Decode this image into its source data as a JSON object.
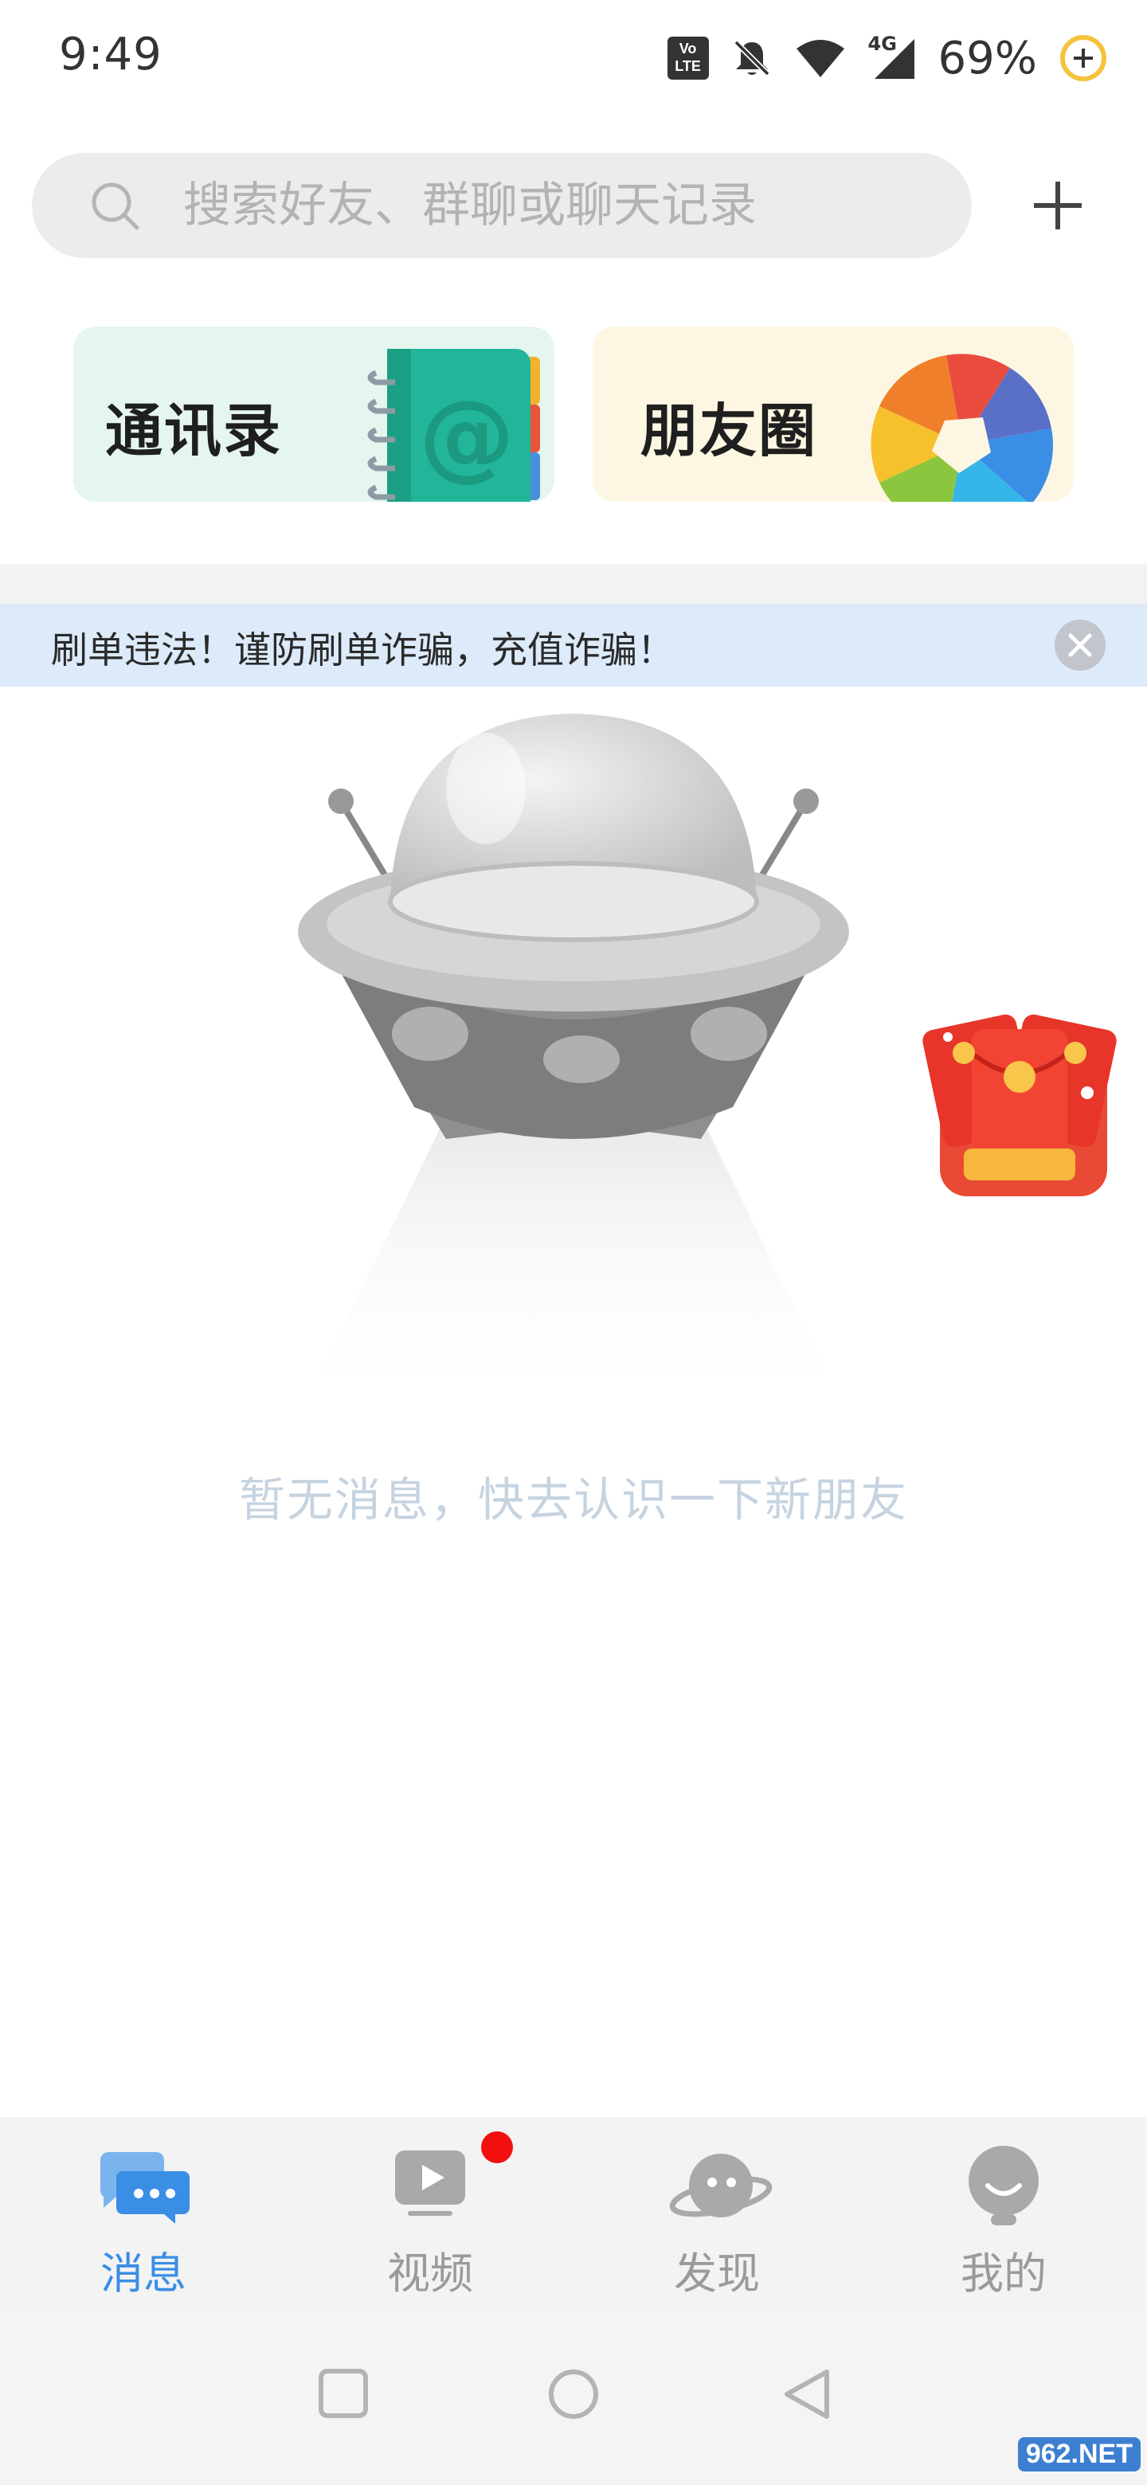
{
  "status_bar": {
    "time": "9:49",
    "network": "4G",
    "battery_percent": "69%",
    "icons": [
      "volte-icon",
      "mute-bell-icon",
      "wifi-icon",
      "signal-icon",
      "battery-saver-icon"
    ]
  },
  "search": {
    "placeholder": "搜索好友、群聊或聊天记录",
    "value": ""
  },
  "shortcuts": {
    "contacts_label": "通讯录",
    "moments_label": "朋友圈"
  },
  "notice": {
    "text": "刷单违法！谨防刷单诈骗，充值诈骗！"
  },
  "empty_state": {
    "text": "暂无消息，快去认识一下新朋友"
  },
  "tabs": [
    {
      "label": "消息",
      "active": true
    },
    {
      "label": "视频",
      "active": false,
      "badge": true
    },
    {
      "label": "发现",
      "active": false
    },
    {
      "label": "我的",
      "active": false
    }
  ],
  "colors": {
    "accent": "#3a8ee6",
    "badge": "#f2100e",
    "notice_bg": "#dceaf9",
    "contacts_card_bg": "#e5f6ee",
    "moments_card_bg": "#fdf6e2"
  }
}
